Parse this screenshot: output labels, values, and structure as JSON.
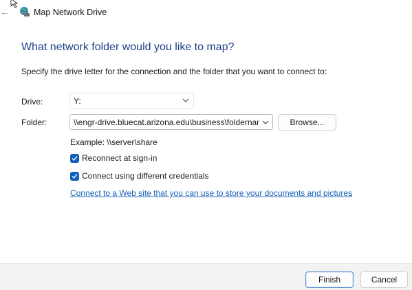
{
  "window": {
    "title": "Map Network Drive",
    "back_icon": "back-arrow-icon",
    "app_icon": "network-drive-icon"
  },
  "heading": "What network folder would you like to map?",
  "instruction": "Specify the drive letter for the connection and the folder that you want to connect to:",
  "drive": {
    "label": "Drive:",
    "value": "Y:"
  },
  "folder": {
    "label": "Folder:",
    "value": "\\\\engr-drive.bluecat.arizona.edu\\business\\foldername",
    "browse_label": "Browse..."
  },
  "example": "Example: \\\\server\\share",
  "options": {
    "reconnect": {
      "label": "Reconnect at sign-in",
      "checked": true
    },
    "different_credentials": {
      "label": "Connect using different credentials",
      "checked": true
    }
  },
  "web_link": {
    "text": "Connect to a Web site that you can use to store your documents and pictures",
    "trailing": "."
  },
  "footer": {
    "finish_label": "Finish",
    "cancel_label": "Cancel"
  },
  "colors": {
    "heading": "#1c3f8a",
    "link": "#1b62b8",
    "checkbox": "#0f5fb8",
    "footer_bg": "#f3f3f3"
  }
}
